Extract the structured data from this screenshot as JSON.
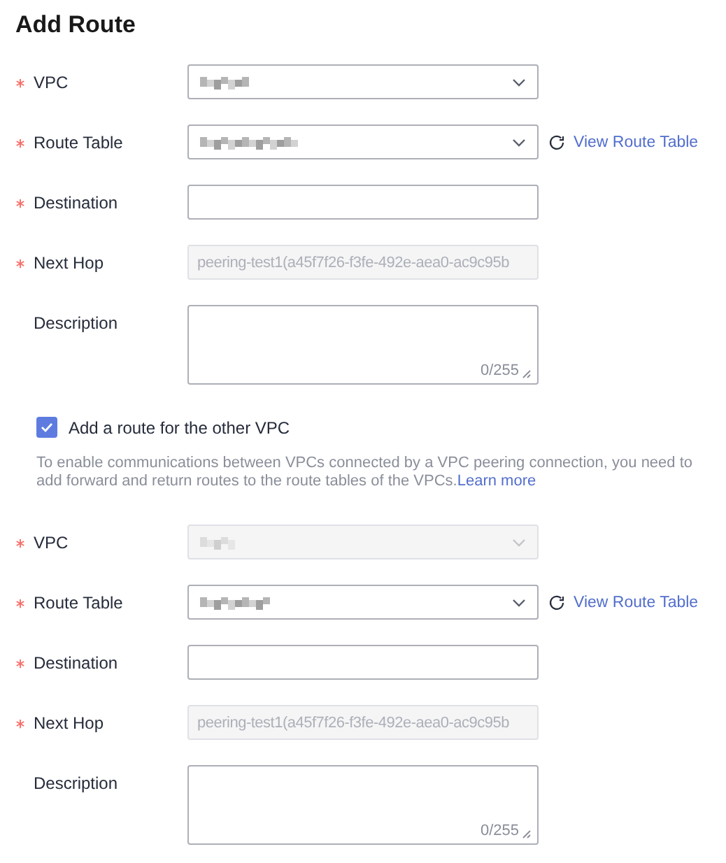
{
  "title": "Add Route",
  "sections": [
    {
      "fields": [
        {
          "kind": "select",
          "label": "VPC",
          "required": true,
          "disabled": false,
          "redacted": true
        },
        {
          "kind": "select",
          "label": "Route Table",
          "required": true,
          "disabled": false,
          "redacted": true,
          "link": "View Route Table"
        },
        {
          "kind": "input",
          "label": "Destination",
          "required": true,
          "disabled": false
        },
        {
          "kind": "input",
          "label": "Next Hop",
          "required": true,
          "disabled": true,
          "value": "peering-test1(a45f7f26-f3fe-492e-aea0-ac9c95b"
        },
        {
          "kind": "textarea",
          "label": "Description",
          "required": false,
          "counter": "0/255"
        }
      ]
    },
    {
      "checkbox": {
        "label": "Add a route for the other VPC",
        "checked": true
      },
      "note": "To enable communications between VPCs connected by a VPC peering connection, you need to add forward and return routes to the route tables of the VPCs.",
      "note_link": "Learn more",
      "fields": [
        {
          "kind": "select",
          "label": "VPC",
          "required": true,
          "disabled": true,
          "redacted": true
        },
        {
          "kind": "select",
          "label": "Route Table",
          "required": true,
          "disabled": false,
          "redacted": true,
          "link": "View Route Table"
        },
        {
          "kind": "input",
          "label": "Destination",
          "required": true,
          "disabled": false
        },
        {
          "kind": "input",
          "label": "Next Hop",
          "required": true,
          "disabled": true,
          "value": "peering-test1(a45f7f26-f3fe-492e-aea0-ac9c95b"
        },
        {
          "kind": "textarea",
          "label": "Description",
          "required": false,
          "counter": "0/255"
        }
      ]
    }
  ]
}
